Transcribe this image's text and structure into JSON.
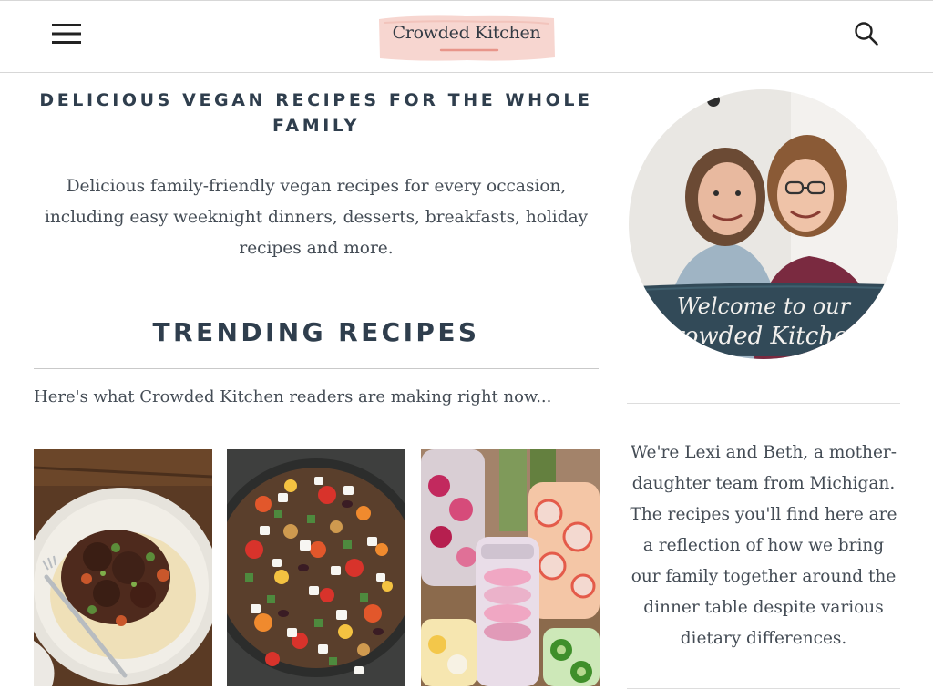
{
  "header": {
    "logo_text": "Crowded Kitchen",
    "menu_icon": "hamburger-menu-icon",
    "search_icon": "magnifier-search-icon"
  },
  "hero": {
    "title": "DELICIOUS VEGAN RECIPES FOR THE WHOLE FAMILY",
    "description": "Delicious family-friendly vegan recipes for every occasion, including easy weeknight dinners, desserts, breakfasts, holiday recipes and more."
  },
  "trending": {
    "title": "TRENDING RECIPES",
    "intro": "Here's what Crowded Kitchen readers are making right now..."
  },
  "recipes": [
    {
      "image": "stew-over-mashed-potatoes-photo"
    },
    {
      "image": "chopped-salad-with-feta-photo"
    },
    {
      "image": "pickled-vegetables-in-jars-photo"
    }
  ],
  "sidebar": {
    "welcome_banner_line1": "Welcome to our",
    "welcome_banner_line2": "Crowded Kitchen!",
    "bio": "We're Lexi and Beth, a mother-daughter team from Michigan. The recipes you'll find here are a reflection of how we bring our family together around the dinner table despite various dietary differences."
  },
  "colors": {
    "heading": "#2f3e4d",
    "body_text": "#444c55",
    "logo_badge": "#f7d6d0",
    "banner": "#324a58",
    "divider": "#d7d7d7"
  }
}
